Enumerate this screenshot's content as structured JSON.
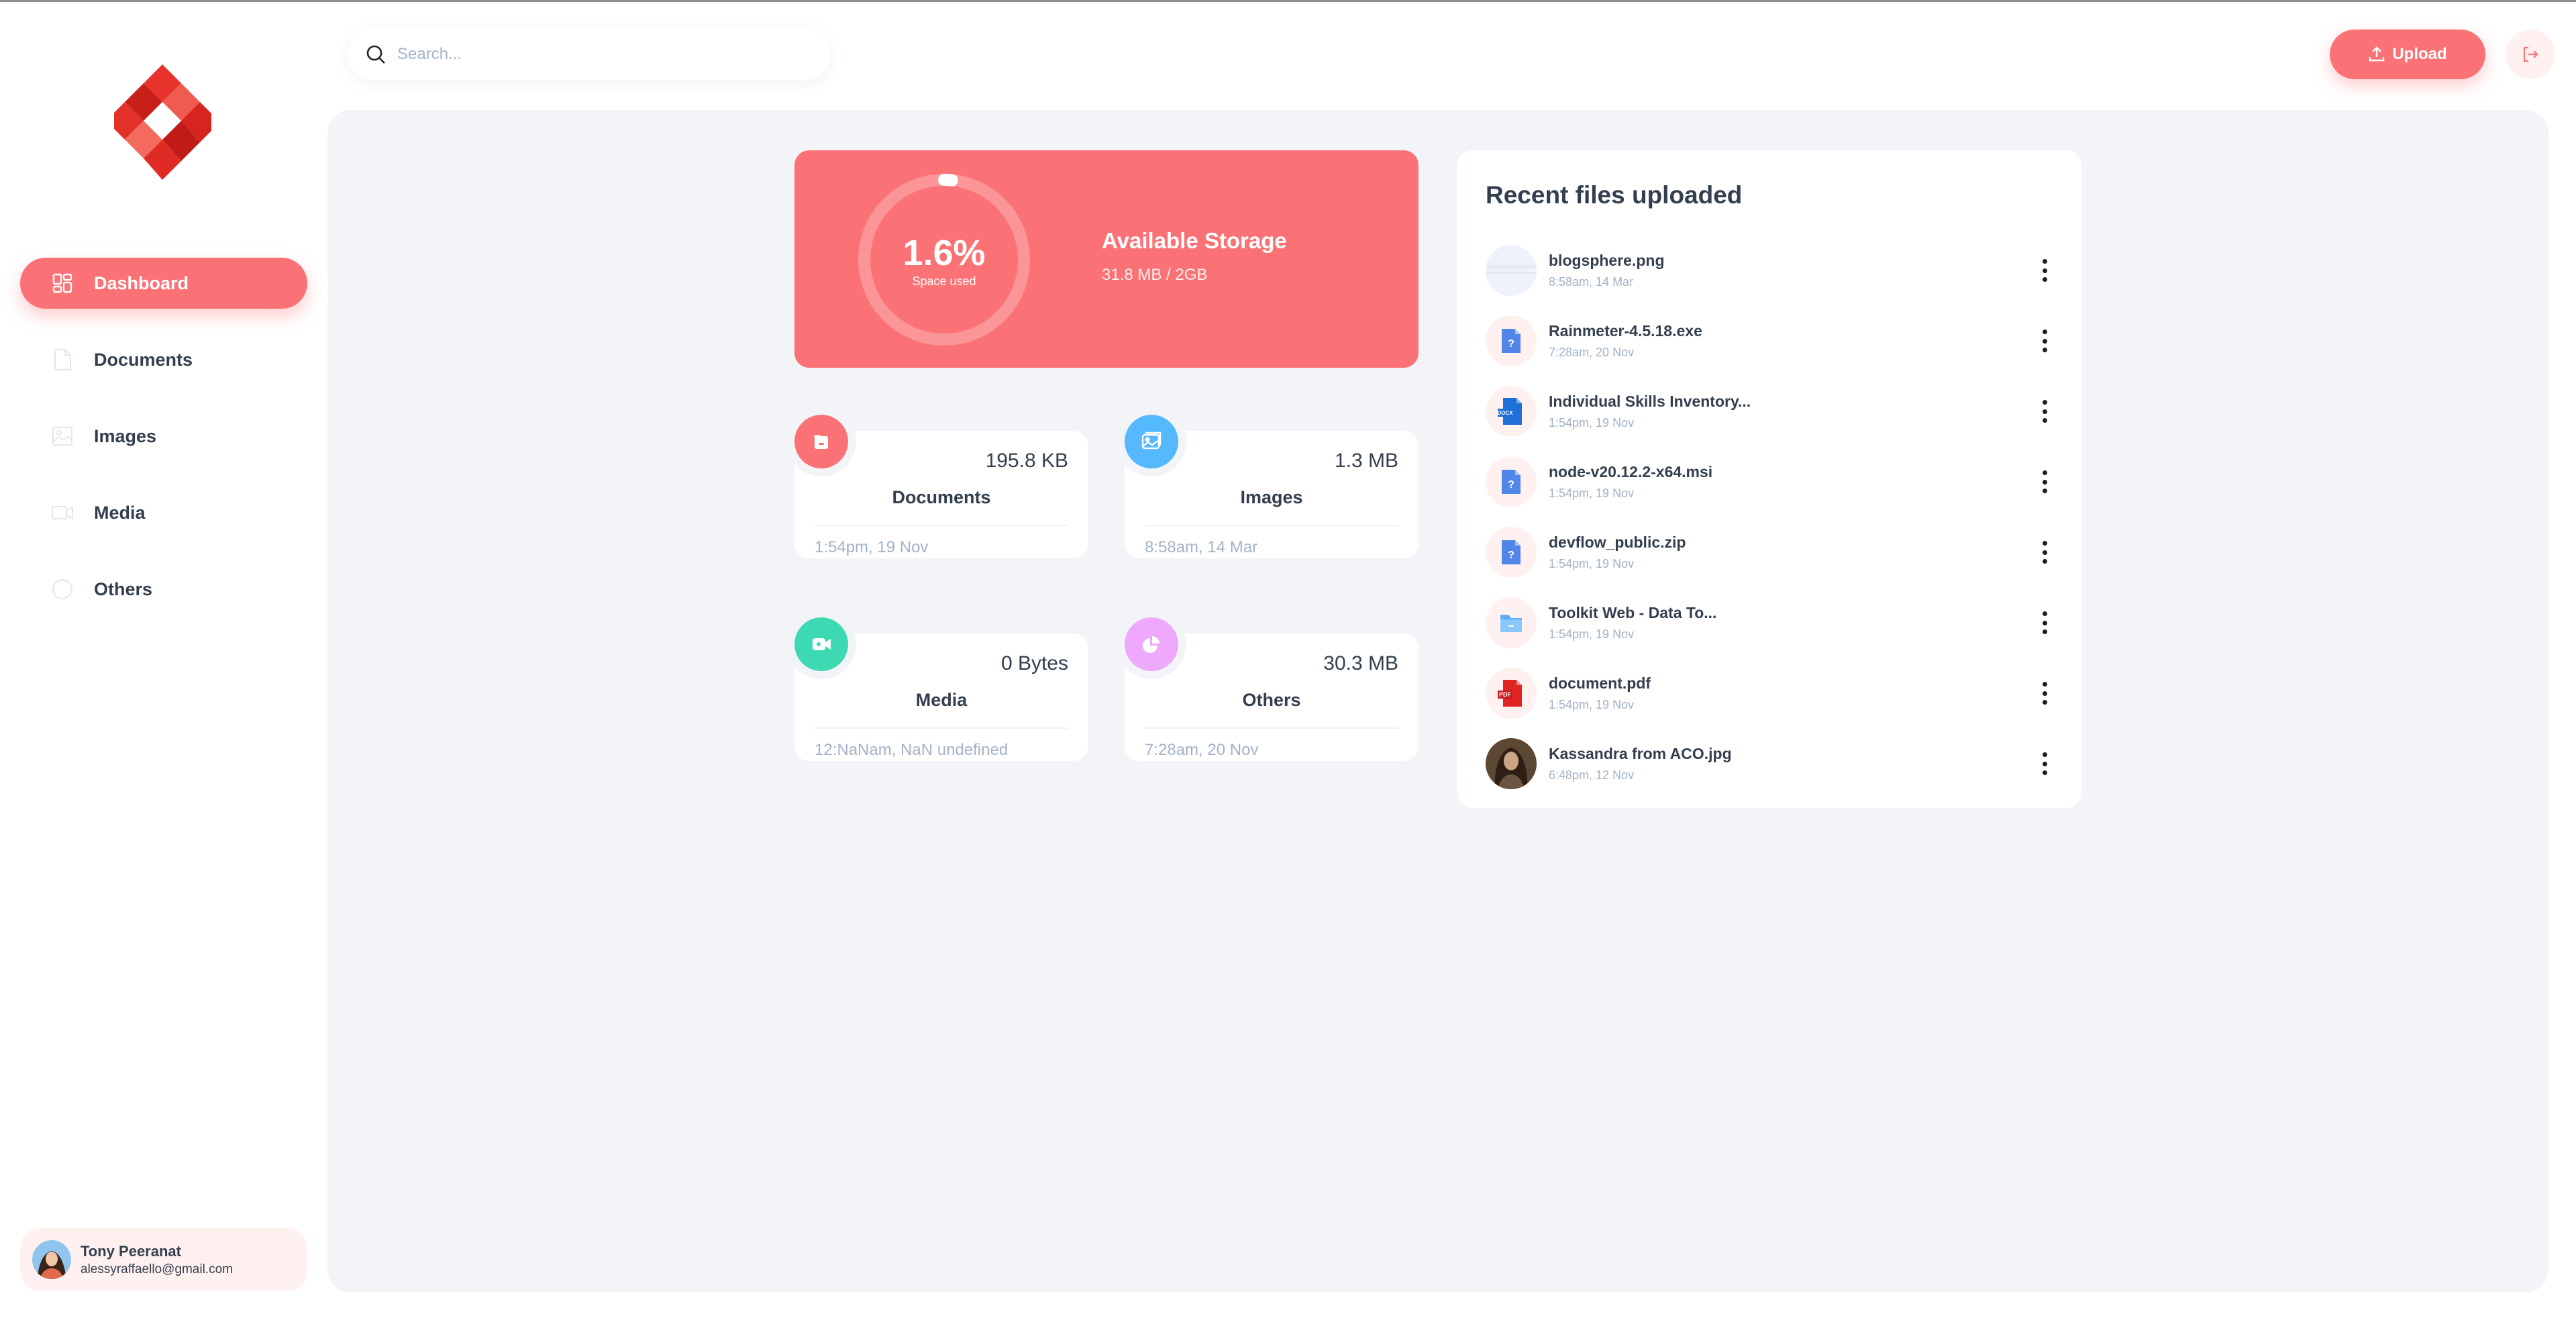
{
  "sidebar": {
    "nav": [
      {
        "label": "Dashboard",
        "icon": "dashboard-icon",
        "active": true
      },
      {
        "label": "Documents",
        "icon": "document-icon",
        "active": false
      },
      {
        "label": "Images",
        "icon": "image-icon",
        "active": false
      },
      {
        "label": "Media",
        "icon": "video-icon",
        "active": false
      },
      {
        "label": "Others",
        "icon": "pie-chart-icon",
        "active": false
      }
    ],
    "user": {
      "name": "Tony Peeranat",
      "email": "alessyraffaello@gmail.com"
    }
  },
  "header": {
    "search_placeholder": "Search...",
    "upload_label": "Upload"
  },
  "storage": {
    "percent_label": "1.6%",
    "percent_value": 1.6,
    "space_used_label": "Space used",
    "title": "Available Storage",
    "usage": "31.8 MB / 2GB"
  },
  "stats": [
    {
      "label": "Documents",
      "size": "195.8 KB",
      "date": "1:54pm, 19 Nov",
      "icon": "folder-icon",
      "color": "#fa7275"
    },
    {
      "label": "Images",
      "size": "1.3 MB",
      "date": "8:58am, 14 Mar",
      "icon": "image-icon",
      "color": "#56b8ff"
    },
    {
      "label": "Media",
      "size": "0 Bytes",
      "date": "12:NaNam, NaN undefined",
      "icon": "video-icon",
      "color": "#3dd9b3"
    },
    {
      "label": "Others",
      "size": "30.3 MB",
      "date": "7:28am, 20 Nov",
      "icon": "pie-chart-icon",
      "color": "#eea8fd"
    }
  ],
  "recent": {
    "title": "Recent files uploaded",
    "files": [
      {
        "name": "blogsphere.png",
        "date": "8:58am, 14 Mar",
        "thumb": "image-thumb-icon"
      },
      {
        "name": "Rainmeter-4.5.18.exe",
        "date": "7:28am, 20 Nov",
        "thumb": "unknown-file-icon"
      },
      {
        "name": "Individual Skills Inventory...",
        "date": "1:54pm, 19 Nov",
        "thumb": "docx-file-icon"
      },
      {
        "name": "node-v20.12.2-x64.msi",
        "date": "1:54pm, 19 Nov",
        "thumb": "unknown-file-icon"
      },
      {
        "name": "devflow_public.zip",
        "date": "1:54pm, 19 Nov",
        "thumb": "unknown-file-icon"
      },
      {
        "name": "Toolkit Web - Data To...",
        "date": "1:54pm, 19 Nov",
        "thumb": "folder-file-icon"
      },
      {
        "name": "document.pdf",
        "date": "1:54pm, 19 Nov",
        "thumb": "pdf-file-icon"
      },
      {
        "name": "Kassandra from ACO.jpg",
        "date": "6:48pm, 12 Nov",
        "thumb": "photo-thumb-icon"
      }
    ]
  },
  "colors": {
    "brand": "#fa7275",
    "brand_light": "#fff1f0",
    "main_bg": "#f2f4f8",
    "text": "#333f4e",
    "muted": "#a3b2c7"
  }
}
